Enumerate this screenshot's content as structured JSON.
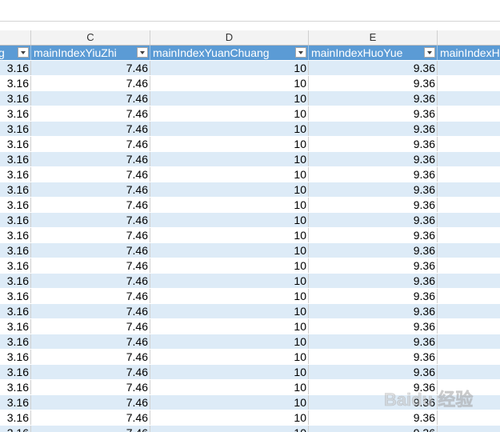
{
  "column_letters": [
    "C",
    "D",
    "E"
  ],
  "headers": {
    "b": "g",
    "c": "mainIndexYiuZhi",
    "d": "mainIndexYuanChuang",
    "e": "mainIndexHuoYue",
    "f": "mainIndexH"
  },
  "row_values": {
    "b": "3.16",
    "c": "7.46",
    "d": "10",
    "e": "9.36"
  },
  "visible_data_rows": 24,
  "colors": {
    "header_fill": "#5b9bd5",
    "band_fill": "#ddebf7",
    "plain_fill": "#ffffff"
  },
  "watermark": "Baidu 经验"
}
